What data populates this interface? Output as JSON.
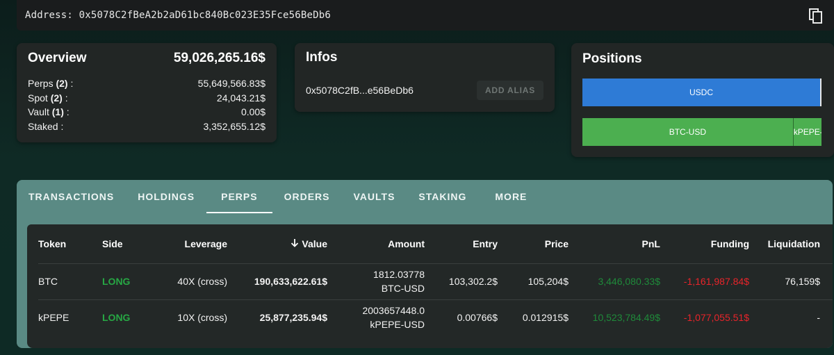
{
  "address_bar": {
    "text": "Address: 0x5078C2fBeA2b2aD61bc840Bc023E35Fce56BeDb6",
    "copy_icon": "copy-icon"
  },
  "overview": {
    "title": "Overview",
    "total": "59,026,265.16$",
    "rows": [
      {
        "label": "Perps",
        "count": "(2)",
        "value": "55,649,566.83$"
      },
      {
        "label": "Spot",
        "count": "(2)",
        "value": "24,043.21$"
      },
      {
        "label": "Vault",
        "count": "(1)",
        "value": "0.00$"
      },
      {
        "label": "Staked",
        "count": "",
        "value": "3,352,655.12$"
      }
    ]
  },
  "infos": {
    "title": "Infos",
    "address_short": "0x5078C2fB...e56BeDb6",
    "alias_button": "ADD ALIAS"
  },
  "positions": {
    "title": "Positions",
    "bars": [
      {
        "segments": [
          {
            "label": "USDC",
            "share": 1.0
          }
        ]
      },
      {
        "segments": [
          {
            "label": "BTC-USD",
            "share": 0.88
          },
          {
            "label": "kPEPE-USD",
            "share": 0.12
          }
        ]
      }
    ],
    "colors": {
      "usdc": "#2e7bd6",
      "perps": "#4caf50"
    }
  },
  "tabs": [
    "TRANSACTIONS",
    "HOLDINGS",
    "PERPS",
    "ORDERS",
    "VAULTS",
    "STAKING",
    "MORE"
  ],
  "active_tab": "PERPS",
  "table": {
    "headers": [
      "Token",
      "Side",
      "Leverage",
      "Value",
      "Amount",
      "Entry",
      "Price",
      "PnL",
      "Funding",
      "Liquidation"
    ],
    "sort_icon": "arrow-down-icon",
    "rows": [
      {
        "token": "BTC",
        "side": "LONG",
        "leverage": "40X (cross)",
        "value": "190,633,622.61$",
        "amount_qty": "1812.03778",
        "amount_unit": "BTC-USD",
        "entry": "103,302.2$",
        "price": "105,204$",
        "pnl": "3,446,080.33$",
        "funding": "-1,161,987.84$",
        "liquidation": "76,159$"
      },
      {
        "token": "kPEPE",
        "side": "LONG",
        "leverage": "10X (cross)",
        "value": "25,877,235.94$",
        "amount_qty": "2003657448.0",
        "amount_unit": "kPEPE-USD",
        "entry": "0.00766$",
        "price": "0.012915$",
        "pnl": "10,523,784.49$",
        "funding": "-1,077,055.51$",
        "liquidation": "-"
      }
    ]
  }
}
